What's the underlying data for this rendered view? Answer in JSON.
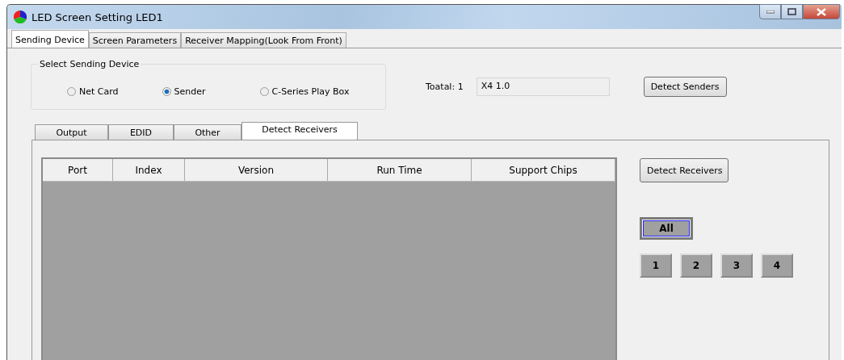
{
  "window": {
    "title": "LED Screen Setting LED1"
  },
  "tabs": [
    {
      "label": "Sending Device",
      "selected": true
    },
    {
      "label": "Screen Parameters",
      "selected": false
    },
    {
      "label": "Receiver Mapping(Look From Front)",
      "selected": false
    }
  ],
  "sending_device": {
    "legend": "Select Sending Device",
    "options": [
      {
        "label": "Net Card",
        "selected": false
      },
      {
        "label": "Sender",
        "selected": true
      },
      {
        "label": "C-Series Play Box",
        "selected": false
      }
    ]
  },
  "total": {
    "label": "Toatal: 1",
    "value": "X4 1.0"
  },
  "detect_senders": "Detect Senders",
  "sub_tabs": [
    {
      "label": "Output",
      "selected": false
    },
    {
      "label": "EDID",
      "selected": false
    },
    {
      "label": "Other",
      "selected": false
    },
    {
      "label": "Detect Receivers",
      "selected": true
    }
  ],
  "table": {
    "columns": [
      "Port",
      "Index",
      "Version",
      "Run Time",
      "Support Chips"
    ]
  },
  "detect_receivers": "Detect Receivers",
  "all_button": {
    "label": "All",
    "selected": true
  },
  "port_buttons": [
    {
      "label": "1",
      "selected": false
    },
    {
      "label": "2",
      "selected": false
    },
    {
      "label": "3",
      "selected": false
    },
    {
      "label": "4",
      "selected": false
    }
  ]
}
